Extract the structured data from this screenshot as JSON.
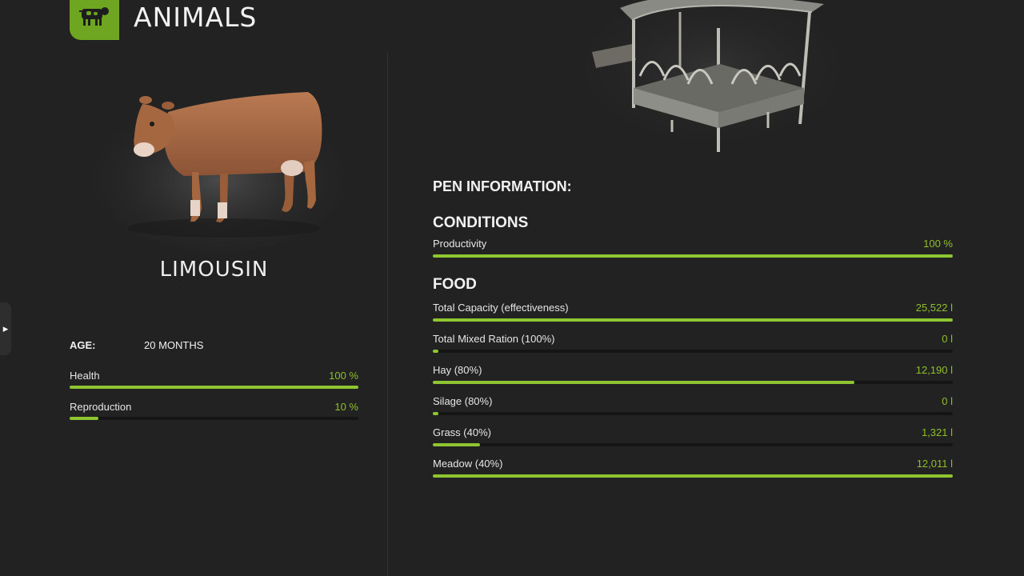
{
  "header": {
    "title": "ANIMALS",
    "icon": "cow-icon",
    "accent": "#6ea521"
  },
  "animal": {
    "breed": "LIMOUSIN",
    "age_label": "AGE:",
    "age_value": "20 MONTHS",
    "stats": [
      {
        "label": "Health",
        "value": "100 %",
        "fraction": 1.0
      },
      {
        "label": "Reproduction",
        "value": "10 %",
        "fraction": 0.1
      }
    ]
  },
  "pen": {
    "heading": "PEN INFORMATION:",
    "conditions": {
      "heading": "CONDITIONS",
      "items": [
        {
          "label": "Productivity",
          "value": "100 %",
          "fraction": 1.0
        }
      ]
    },
    "food": {
      "heading": "FOOD",
      "items": [
        {
          "label": "Total Capacity (effectiveness)",
          "value": "25,522 l",
          "fraction": 1.0
        },
        {
          "label": "Total Mixed Ration (100%)",
          "value": "0 l",
          "fraction": 0.0
        },
        {
          "label": "Hay (80%)",
          "value": "12,190 l",
          "fraction": 0.81
        },
        {
          "label": "Silage (80%)",
          "value": "0 l",
          "fraction": 0.0
        },
        {
          "label": "Grass (40%)",
          "value": "1,321 l",
          "fraction": 0.09
        },
        {
          "label": "Meadow (40%)",
          "value": "12,011 l",
          "fraction": 1.0
        }
      ]
    }
  },
  "colors": {
    "bar_fill": "#8fc530",
    "value_text": "#8fbf2a",
    "background": "#222222"
  }
}
